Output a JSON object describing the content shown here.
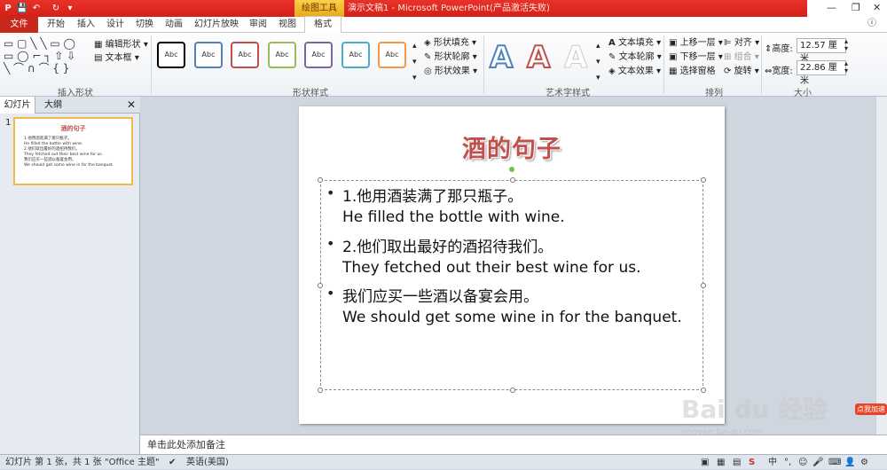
{
  "window": {
    "title": "演示文稿1 - Microsoft PowerPoint(产品激活失败)",
    "context_tab": "绘图工具"
  },
  "tabs": [
    "文件",
    "开始",
    "插入",
    "设计",
    "切换",
    "动画",
    "幻灯片放映",
    "审阅",
    "视图",
    "格式"
  ],
  "ribbon": {
    "groups": {
      "insert_shapes": "插入形状",
      "shape_styles": "形状样式",
      "wordart_styles": "艺术字样式",
      "arrange": "排列",
      "size": "大小"
    },
    "edit_shape": "编辑形状",
    "text_box": "文本框",
    "shape_fill": "形状填充",
    "shape_outline": "形状轮廓",
    "shape_effects": "形状效果",
    "style_sample": "Abc",
    "text_fill": "文本填充",
    "text_outline": "文本轮廓",
    "text_effects": "文本效果",
    "bring_forward": "上移一层",
    "send_backward": "下移一层",
    "selection_pane": "选择窗格",
    "align": "对齐",
    "group": "组合",
    "rotate": "旋转",
    "height_label": "高度:",
    "height_value": "12.57 厘米",
    "width_label": "宽度:",
    "width_value": "22.86 厘米",
    "wordart_letter": "A"
  },
  "colors": {
    "style_borders": [
      "#000000",
      "#4f81bd",
      "#c0504d",
      "#9bbb59",
      "#8064a2",
      "#4bacc6",
      "#f79646"
    ],
    "wordart": [
      "#4f81bd",
      "#c0504d",
      "#cccccc"
    ]
  },
  "left_pane": {
    "tab_slides": "幻灯片",
    "tab_outline": "大纲",
    "slide_number": "1",
    "thumb_title": "酒的句子",
    "thumb_lines": [
      "1.他用酒装满了那只瓶子。",
      "He filled the bottle with wine.",
      "2.他们取出最好的酒招待我们。",
      "They fetched out their best wine for us.",
      "我们应买一些酒以备宴会用。",
      "We should get some wine in for the banquet."
    ]
  },
  "slide": {
    "title": "酒的句子",
    "items": [
      {
        "zh": "1.他用酒装满了那只瓶子。",
        "en": "He filled the bottle with wine."
      },
      {
        "zh": "2.他们取出最好的酒招待我们。",
        "en": "They fetched out their best wine for us."
      },
      {
        "zh": "我们应买一些酒以备宴会用。",
        "en": "We should get some wine in for the banquet."
      }
    ]
  },
  "notes_placeholder": "单击此处添加备注",
  "status": {
    "slide_info": "幻灯片 第 1 张，共 1 张",
    "theme": "\"Office 主题\"",
    "language": "英语(美国)"
  },
  "watermark": {
    "text": "Bai du 经验",
    "url": "jingyan.baidu.com",
    "badge": "点我加速"
  }
}
